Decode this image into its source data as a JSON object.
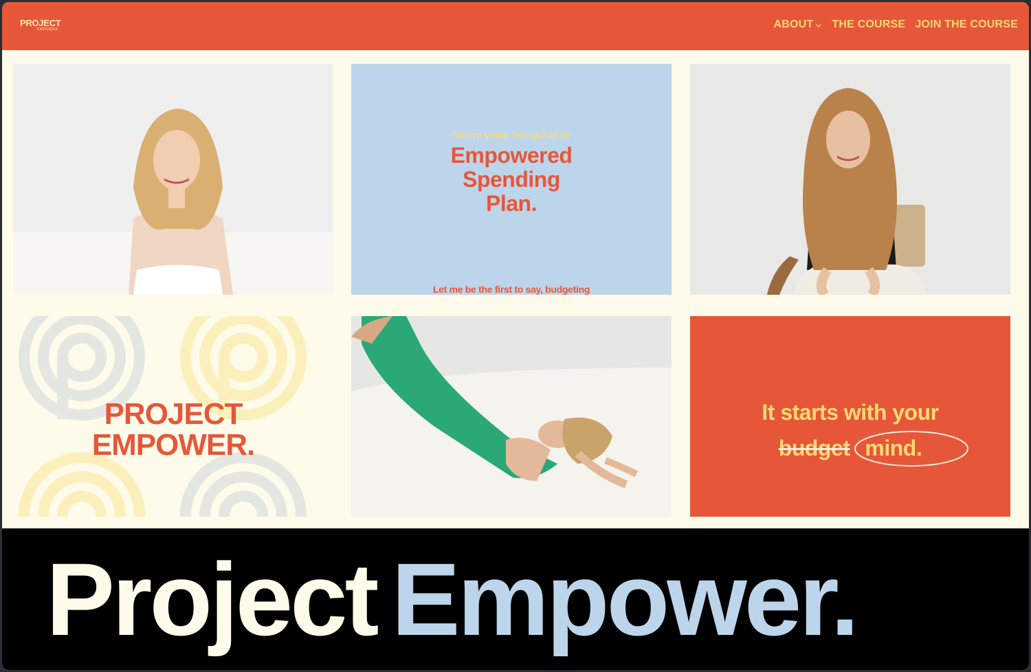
{
  "brand": {
    "logo_main": "PROJECT",
    "logo_sub": "EMPOWER"
  },
  "nav": {
    "items": [
      {
        "label": "ABOUT",
        "has_dropdown": true
      },
      {
        "label": "THE COURSE"
      },
      {
        "label": "JOIN THE COURSE"
      }
    ]
  },
  "tiles": {
    "guide": {
      "kicker": "You're yawn-free guide to",
      "title_line1": "Empowered",
      "title_line2": "Spending",
      "title_line3": "Plan.",
      "footer": "Let me be the first to say, budgeting"
    },
    "brand_block": {
      "line1": "PROJECT",
      "line2": "EMPOWER."
    },
    "mindset": {
      "line1": "It starts with your",
      "struck_word": "budget",
      "circled_word": "mind."
    }
  },
  "banner": {
    "word1": "Project",
    "word2": "Empower."
  },
  "colors": {
    "brand_orange": "#e6573a",
    "brand_yellow": "#fcd873",
    "cream": "#fffbea",
    "sky_blue": "#bdd5ea",
    "black": "#000000"
  }
}
